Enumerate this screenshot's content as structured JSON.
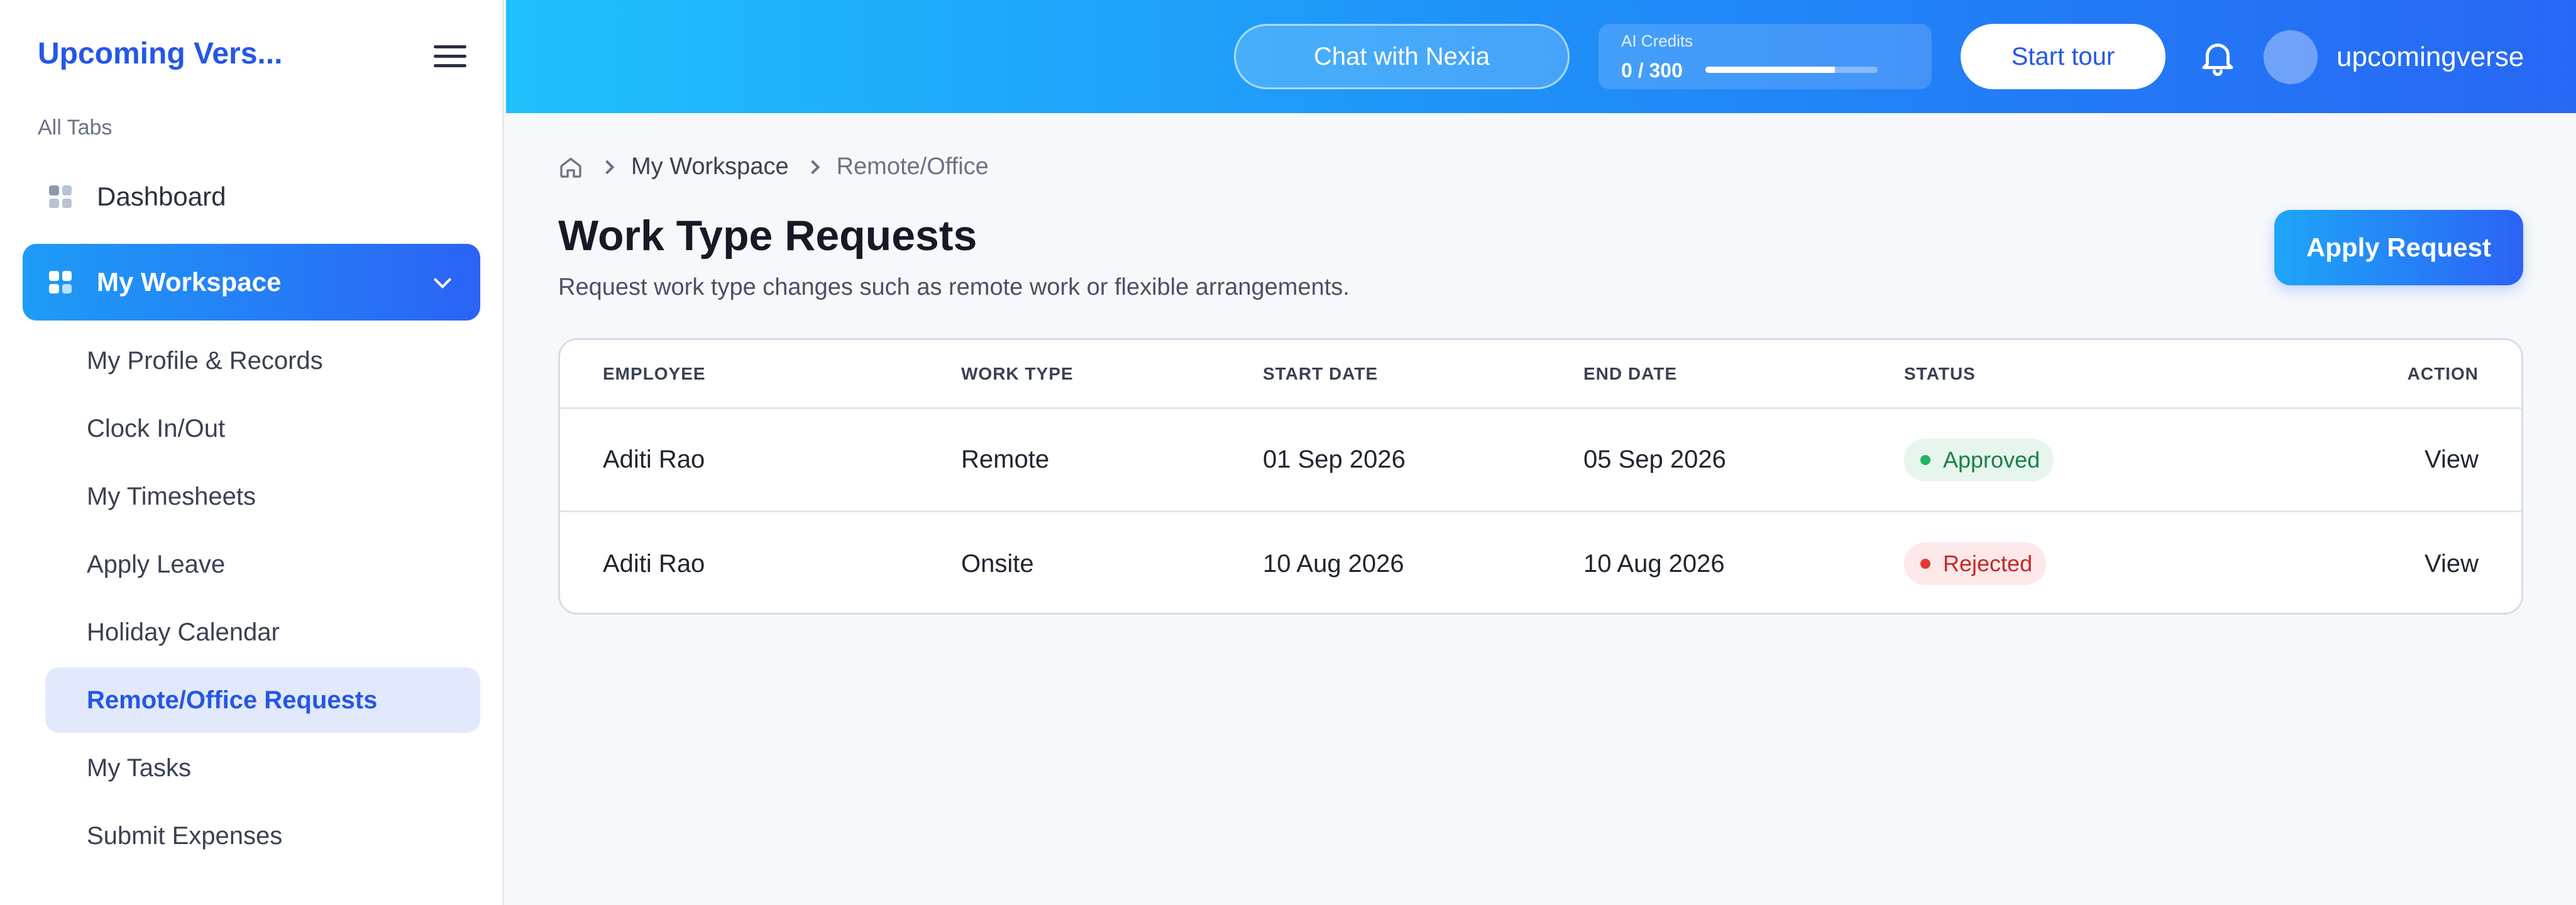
{
  "sidebar": {
    "brand": "Upcoming Vers...",
    "section_label": "All Tabs",
    "dashboard": "Dashboard",
    "workspace": "My Workspace",
    "items": [
      {
        "label": "My Profile & Records"
      },
      {
        "label": "Clock In/Out"
      },
      {
        "label": "My Timesheets"
      },
      {
        "label": "Apply Leave"
      },
      {
        "label": "Holiday Calendar"
      },
      {
        "label": "Remote/Office Requests"
      },
      {
        "label": "My Tasks"
      },
      {
        "label": "Submit Expenses"
      }
    ],
    "active_item": "Remote/Office Requests"
  },
  "topbar": {
    "chat_label": "Chat with Nexia",
    "credits_label": "AI Credits",
    "credits_value": "0 / 300",
    "credits_progress": 0.75,
    "tour_label": "Start tour",
    "username": "upcomingverse"
  },
  "breadcrumb": {
    "items": [
      "My Workspace",
      "Remote/Office"
    ]
  },
  "page": {
    "title": "Work Type Requests",
    "subtitle": "Request work type changes such as remote work or flexible arrangements.",
    "apply_label": "Apply Request"
  },
  "table": {
    "headers": [
      "EMPLOYEE",
      "WORK TYPE",
      "START DATE",
      "END DATE",
      "STATUS",
      "ACTION"
    ],
    "rows": [
      {
        "employee": "Aditi Rao",
        "work_type": "Remote",
        "start": "01 Sep 2026",
        "end": "05 Sep 2026",
        "status": "Approved",
        "action": "View"
      },
      {
        "employee": "Aditi Rao",
        "work_type": "Onsite",
        "start": "10 Aug 2026",
        "end": "10 Aug 2026",
        "status": "Rejected",
        "action": "View"
      }
    ]
  },
  "colors": {
    "accent": "#2456e8",
    "topbar_start": "#1fc0fb",
    "topbar_end": "#2767f4",
    "approved": "#22b35e",
    "rejected": "#e53935"
  },
  "icons": [
    "hamburger-icon",
    "grid-icon",
    "chevron-down-icon",
    "bell-icon",
    "home-icon",
    "chevron-right-icon"
  ]
}
